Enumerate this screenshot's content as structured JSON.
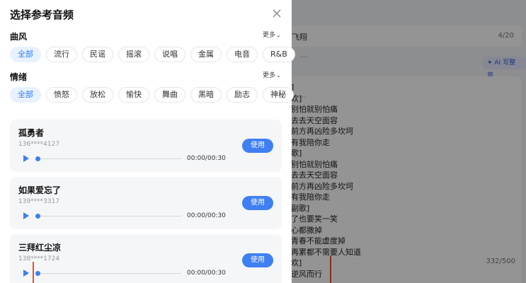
{
  "background": {
    "top_field_text": "飞翔",
    "top_field_counter": "4/20",
    "ai_button_label": "✦ AI 写整首",
    "lyrics": [
      "]",
      "欢]",
      "别怕就别怕痛",
      "去去天空面容",
      "前方再凶险多坎坷",
      "有我陪你走",
      "歌]",
      "别怕就别怕痛",
      "去去天空面容",
      "前方再凶险多坎坷",
      "有我陪你走",
      "副歌]",
      "了也要笑一笑",
      "心都撒掉",
      "青春不能虚度掉",
      "再累都不需要人知道",
      "欢]",
      "逆风而行"
    ],
    "lyrics_counter": "332/500"
  },
  "panel": {
    "title": "选择参考音频",
    "genre": {
      "label": "曲风",
      "more_label": "更多",
      "options": [
        "全部",
        "流行",
        "民谣",
        "摇滚",
        "说唱",
        "金属",
        "电音",
        "R&B"
      ],
      "overflow": "…"
    },
    "mood": {
      "label": "情绪",
      "more_label": "更多",
      "options": [
        "全部",
        "愤怒",
        "放松",
        "愉快",
        "舞曲",
        "黑暗",
        "励志",
        "神秘"
      ],
      "overflow": "…"
    },
    "tracks": [
      {
        "title": "孤勇者",
        "phone": "136****4127",
        "time": "00:00/00:30",
        "use_label": "使用",
        "progress": 0
      },
      {
        "title": "如果爱忘了",
        "phone": "139****3317",
        "time": "00:00/00:30",
        "use_label": "使用",
        "progress": 0
      },
      {
        "title": "三拜红尘凉",
        "phone": "138****1724",
        "time": "00:00/00:30",
        "use_label": "使用",
        "progress": 0
      }
    ]
  },
  "colors": {
    "accent": "#3f7ff4",
    "chip_active_bg": "#e8f1ff",
    "annotation_red": "#e8502f"
  }
}
